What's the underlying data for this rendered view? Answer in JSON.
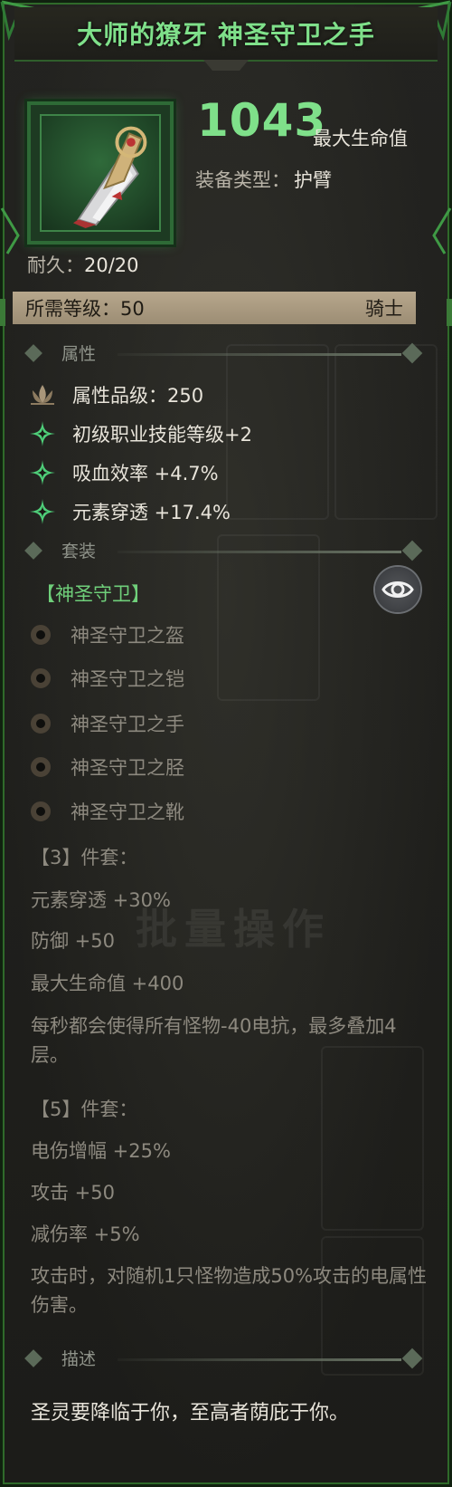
{
  "title": "大师的獠牙 神圣守卫之手",
  "item": {
    "main_stat_value": "1043",
    "main_stat_label": "最大生命值",
    "type_label": "装备类型：",
    "type_value": "护臂",
    "durability_label": "耐久：",
    "durability_value": "20/20",
    "level_label": "所需等级：",
    "level_value": "50",
    "class": "骑士"
  },
  "sections": {
    "attributes": "属性",
    "set": "套装",
    "description": "描述"
  },
  "attributes": [
    {
      "icon": "lotus-icon",
      "text": "属性品级：250"
    },
    {
      "icon": "sparkle-icon",
      "text": "初级职业技能等级+2"
    },
    {
      "icon": "sparkle-icon",
      "text": "吸血效率 +4.7%"
    },
    {
      "icon": "sparkle-icon",
      "text": "元素穿透 +17.4%"
    }
  ],
  "set": {
    "name": "【神圣守卫】",
    "pieces": [
      "神圣守卫之盔",
      "神圣守卫之铠",
      "神圣守卫之手",
      "神圣守卫之胫",
      "神圣守卫之靴"
    ],
    "bonus3_header": "【3】件套：",
    "bonus3": [
      "元素穿透 +30%",
      "防御 +50",
      "最大生命值 +400",
      "每秒都会使得所有怪物-40电抗，最多叠加4层。"
    ],
    "bonus5_header": "【5】件套：",
    "bonus5": [
      "电伤增幅 +25%",
      "攻击 +50",
      "减伤率 +5%",
      "攻击时，对随机1只怪物造成50%攻击的电属性伤害。"
    ]
  },
  "description": "圣灵要降临于你，至高者荫庇于你。",
  "background_ghost_text": "批量操作",
  "colors": {
    "accent_green": "#7fe08a",
    "set_green": "#6fcf7a",
    "level_bar": "#b7a78c",
    "muted_text": "#8d897f"
  }
}
